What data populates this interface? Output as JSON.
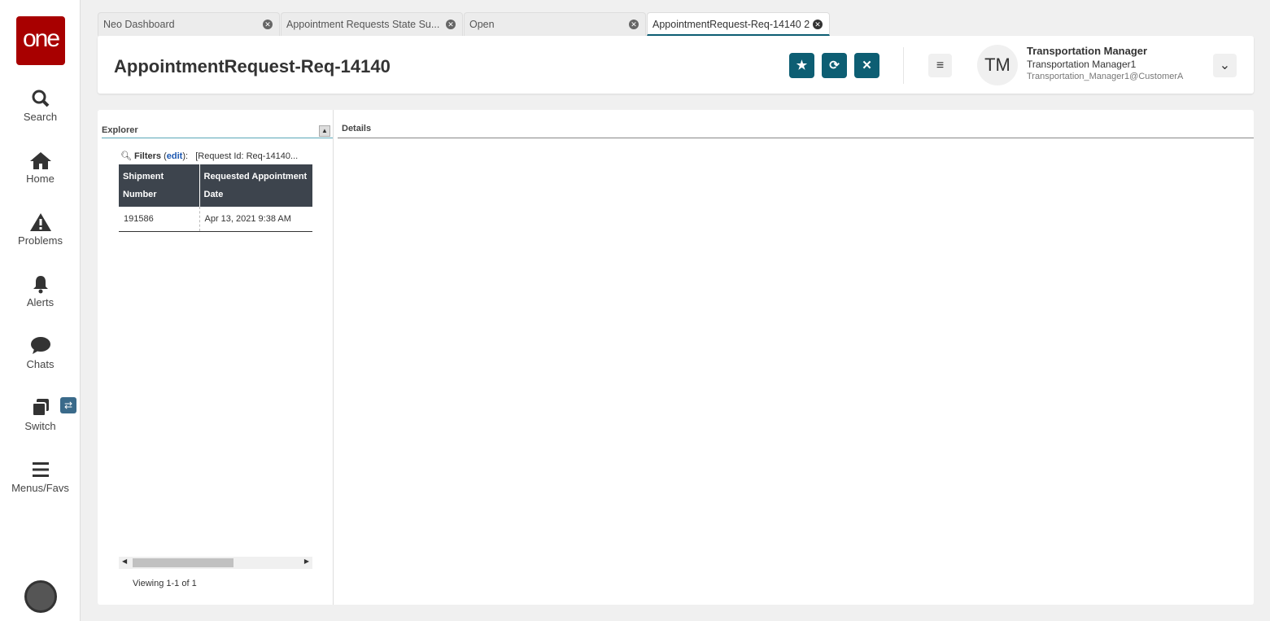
{
  "sidebar": {
    "logo": "one",
    "items": [
      {
        "label": "Search"
      },
      {
        "label": "Home"
      },
      {
        "label": "Problems"
      },
      {
        "label": "Alerts"
      },
      {
        "label": "Chats"
      },
      {
        "label": "Switch"
      },
      {
        "label": "Menus/Favs"
      }
    ]
  },
  "tabs": [
    {
      "label": "Neo Dashboard"
    },
    {
      "label": "Appointment Requests State Su..."
    },
    {
      "label": "Open"
    },
    {
      "label": "AppointmentRequest-Req-14140 2"
    }
  ],
  "header": {
    "title": "AppointmentRequest-Req-14140",
    "user": {
      "initials": "TM",
      "role": "Transportation Manager",
      "name": "Transportation Manager1",
      "account": "Transportation_Manager1@CustomerA"
    }
  },
  "explorer": {
    "title": "Explorer",
    "filters_label": "Filters",
    "edit_label": "edit",
    "filter_value": "[Request Id: Req-14140...",
    "columns": [
      "Shipment Number",
      "Requested Appointment Date"
    ],
    "rows": [
      [
        "191586",
        "Apr 13, 2021 9:38 AM"
      ]
    ],
    "viewing": "Viewing 1-1 of 1"
  },
  "details": {
    "title": "Details"
  },
  "colors": {
    "brand": "#a80000",
    "accent": "#0d5e73"
  }
}
